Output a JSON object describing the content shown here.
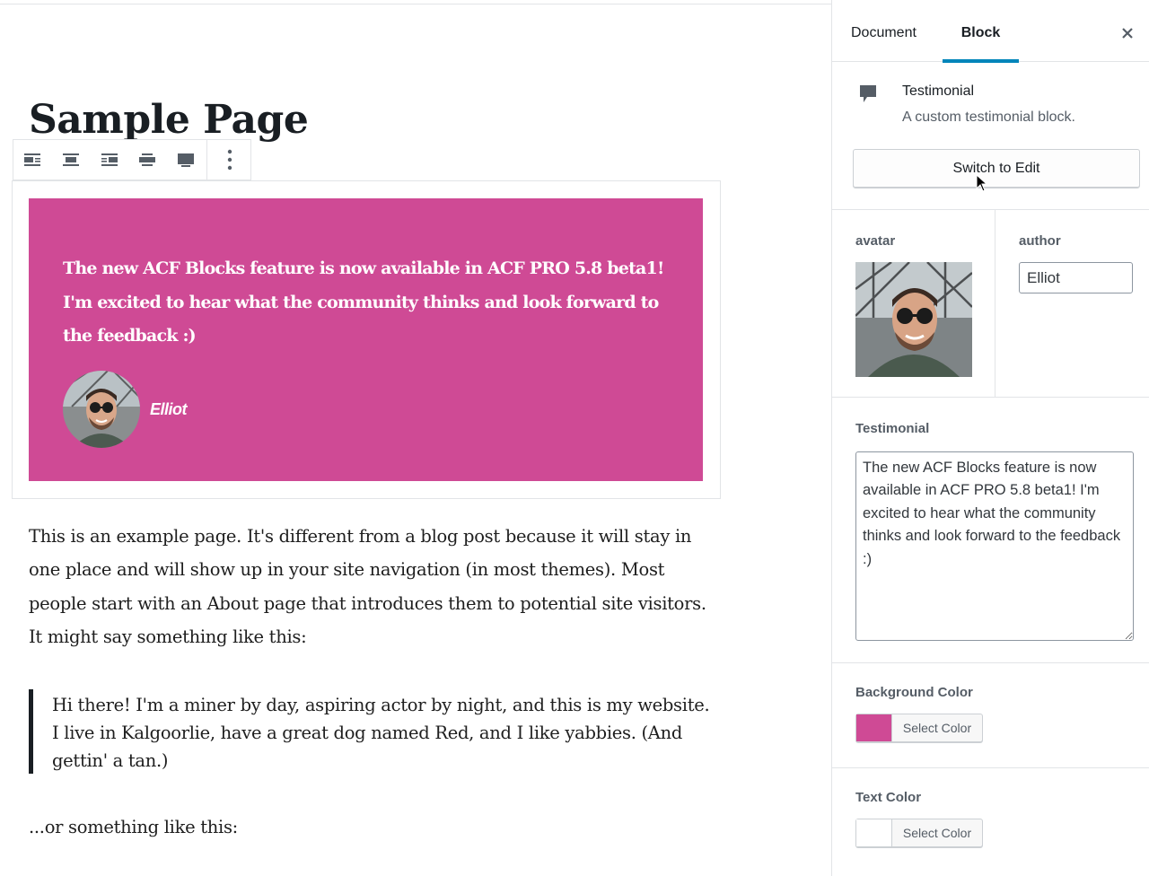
{
  "editor": {
    "post_title": "Sample Page",
    "testimonial_block": {
      "text": "The new ACF Blocks feature is now available in ACF PRO 5.8 beta1! I'm excited to hear what the community thinks and look forward to the feedback :)",
      "author": "Elliot",
      "background_color": "#cf4a95"
    },
    "paragraph": "This is an example page. It's different from a blog post because it will stay in one place and will show up in your site navigation (in most themes). Most people start with an About page that introduces them to potential site visitors. It might say something like this:",
    "quote": "Hi there! I'm a miner by day, aspiring actor by night, and this is my website. I live in Kalgoorlie, have a great dog named Red, and I like yabbies. (And gettin' a tan.)",
    "tail_paragraph": "...or something like this:"
  },
  "toolbar": {
    "icons": [
      "align-left-icon",
      "align-center-icon",
      "align-right-icon",
      "align-wide-icon",
      "align-full-icon",
      "more-options-icon"
    ]
  },
  "sidebar": {
    "tabs": [
      "Document",
      "Block"
    ],
    "active_tab": "Block",
    "close_icon": "close-icon",
    "block_card": {
      "icon": "comment-icon",
      "title": "Testimonial",
      "description": "A custom testimonial block.",
      "switch_button": "Switch to Edit"
    },
    "fields": {
      "avatar_label": "avatar",
      "author_label": "author",
      "author_value": "Elliot",
      "testimonial_label": "Testimonial",
      "testimonial_value": "The new ACF Blocks feature is now available in ACF PRO 5.8 beta1! I'm excited to hear what the community thinks and look forward to the feedback :)",
      "background_color_label": "Background Color",
      "background_color_value": "#cf4a95",
      "text_color_label": "Text Color",
      "text_color_value": "#ffffff",
      "select_color_label": "Select Color"
    }
  },
  "colors": {
    "accent": "#0085ba",
    "testimonial_bg": "#cf4a95"
  }
}
